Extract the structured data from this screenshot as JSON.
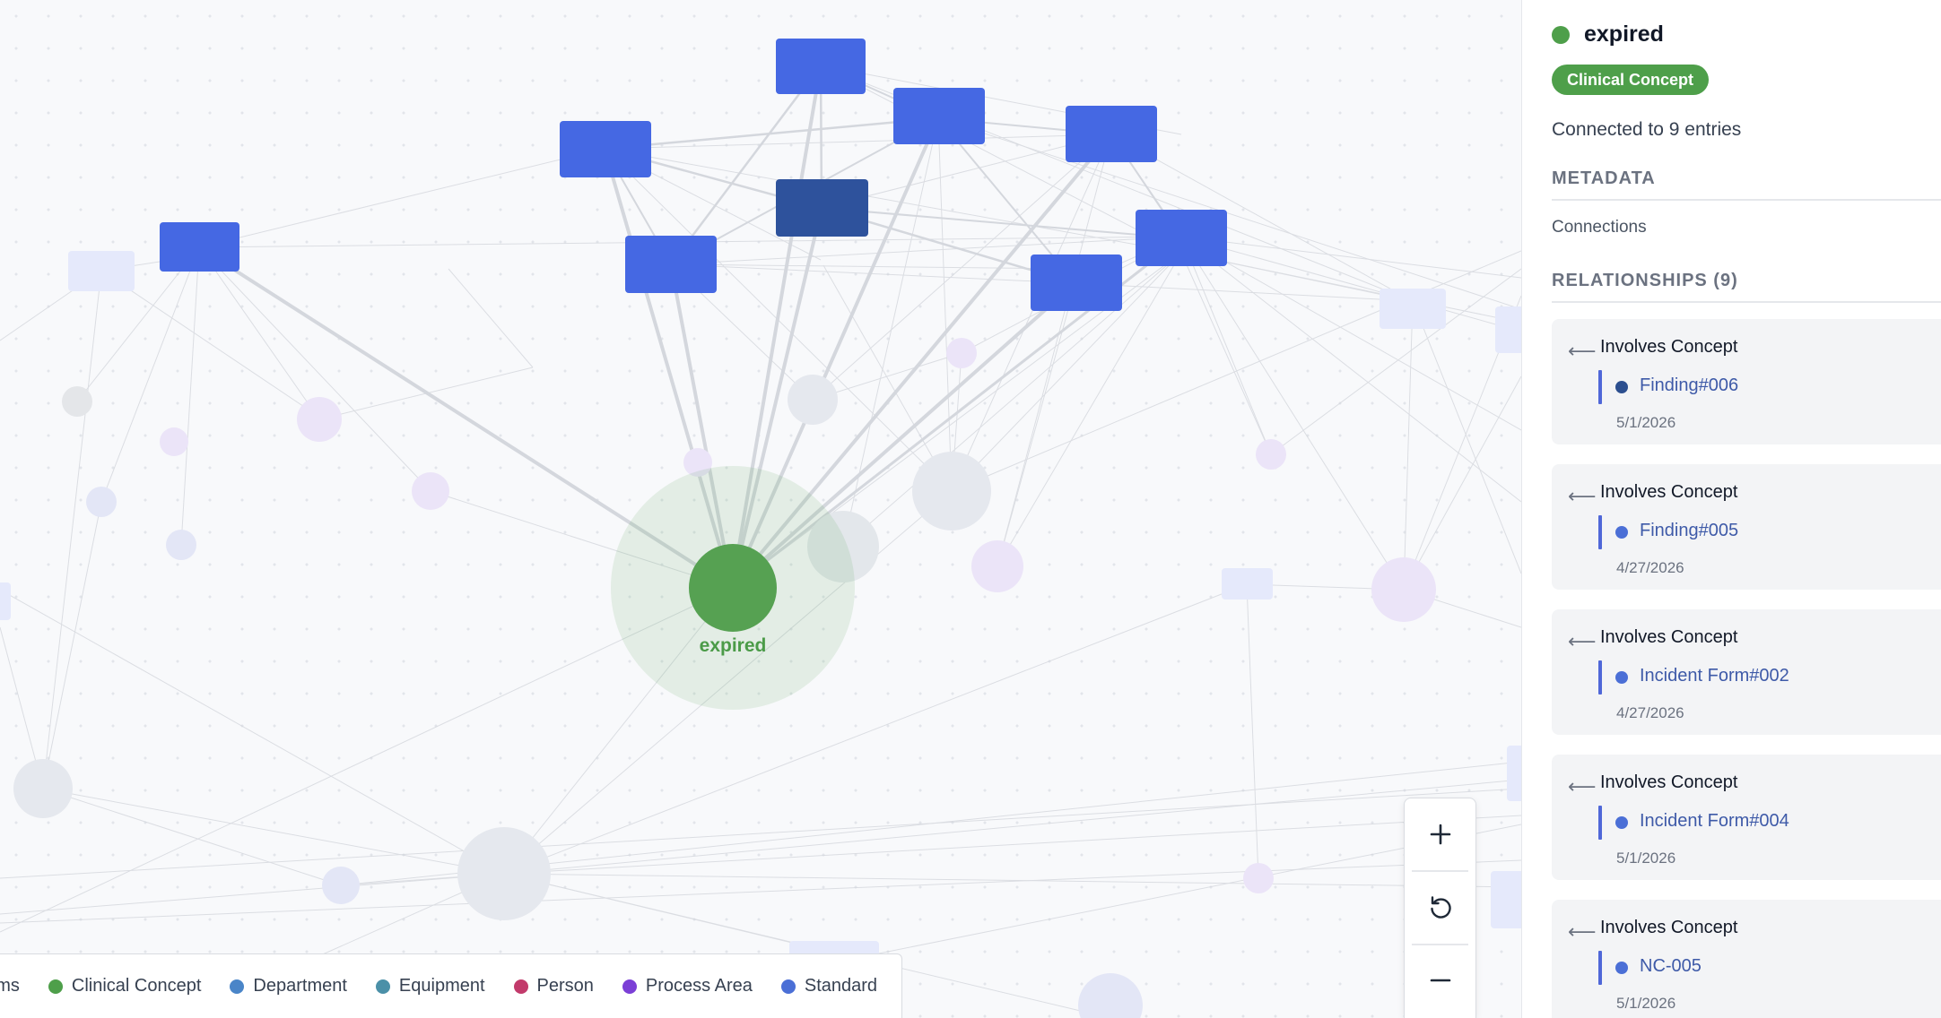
{
  "graph": {
    "selected_node": {
      "label": "expired",
      "type": "Clinical Concept",
      "color": "#56a152"
    }
  },
  "legend": {
    "items": [
      {
        "label": "Items",
        "color": "#4b6fd6"
      },
      {
        "label": "Clinical Concept",
        "color": "#4e9f4a"
      },
      {
        "label": "Department",
        "color": "#4a85c8"
      },
      {
        "label": "Equipment",
        "color": "#4b90a8"
      },
      {
        "label": "Person",
        "color": "#c23a6b"
      },
      {
        "label": "Process Area",
        "color": "#7b3fd6"
      },
      {
        "label": "Standard",
        "color": "#4b6fd6"
      }
    ]
  },
  "zoom": {
    "zoom_in_icon": "plus-icon",
    "reset_icon": "reset-icon",
    "zoom_out_icon": "minus-icon"
  },
  "panel": {
    "title": "expired",
    "title_color": "#4e9f4a",
    "badge": "Clinical Concept",
    "connected_text": "Connected to 9 entries",
    "metadata_heading": "METADATA",
    "metadata_connections_label": "Connections",
    "relationships_heading": "RELATIONSHIPS (9)",
    "relationships": [
      {
        "type": "Involves Concept",
        "target": "Finding#006",
        "dot_color": "#2c4f8f",
        "date": "5/1/2026"
      },
      {
        "type": "Involves Concept",
        "target": "Finding#005",
        "dot_color": "#4b6fd6",
        "date": "4/27/2026"
      },
      {
        "type": "Involves Concept",
        "target": "Incident Form#002",
        "dot_color": "#4b6fd6",
        "date": "4/27/2026"
      },
      {
        "type": "Involves Concept",
        "target": "Incident Form#004",
        "dot_color": "#4b6fd6",
        "date": "5/1/2026"
      },
      {
        "type": "Involves Concept",
        "target": "NC-005",
        "dot_color": "#4b6fd6",
        "date": "5/1/2026"
      }
    ]
  }
}
